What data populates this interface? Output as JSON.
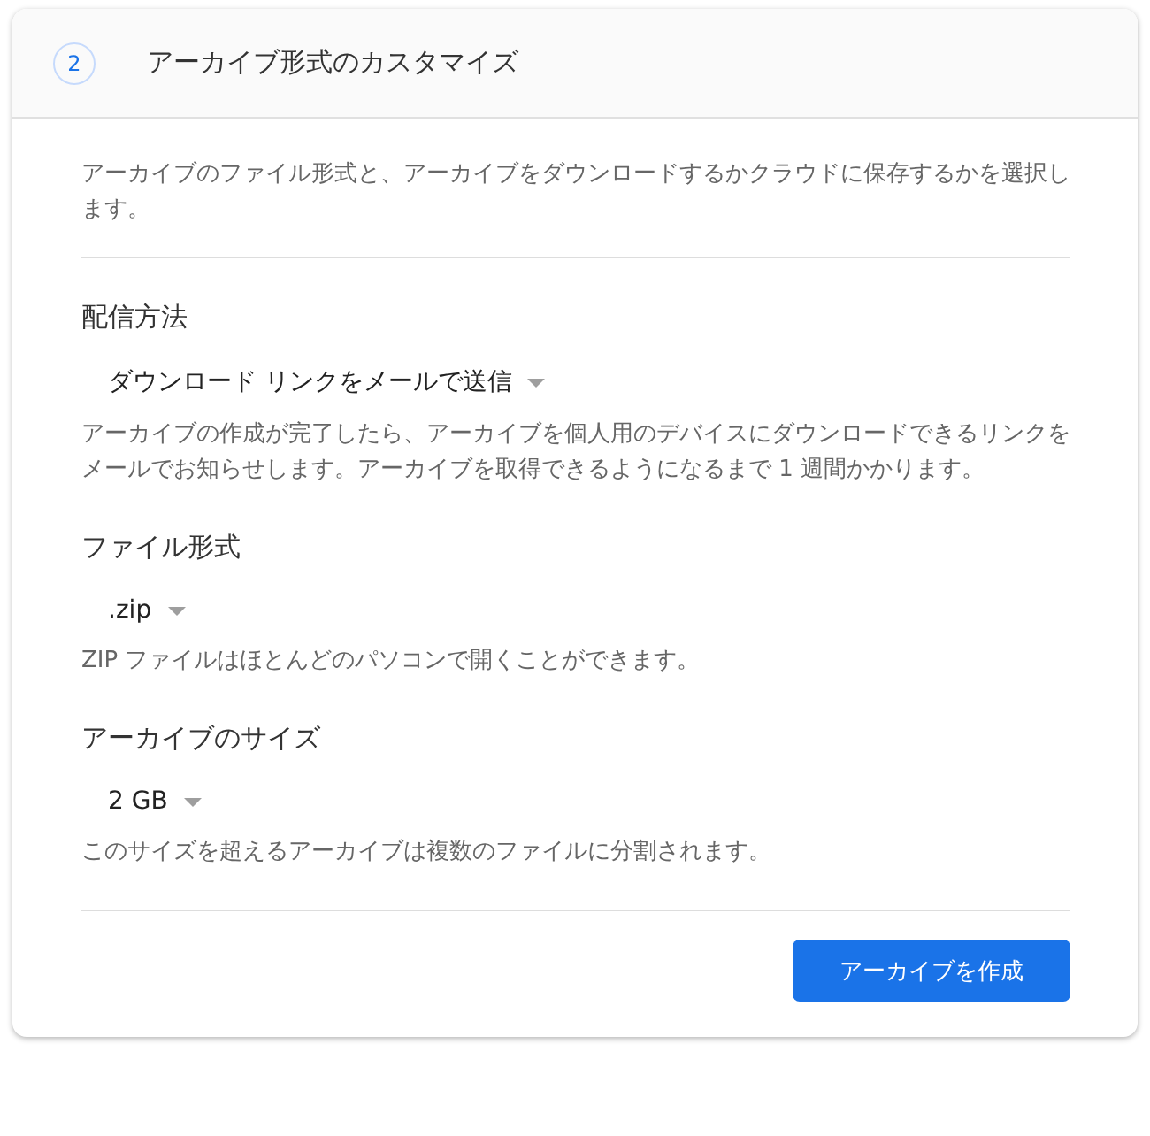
{
  "header": {
    "step": "2",
    "title": "アーカイブ形式のカスタマイズ"
  },
  "intro": "アーカイブのファイル形式と、アーカイブをダウンロードするかクラウドに保存するかを選択します。",
  "sections": [
    {
      "heading": "配信方法",
      "dropdown": "ダウンロード リンクをメールで送信",
      "description": "アーカイブの作成が完了したら、アーカイブを個人用のデバイスにダウンロードできるリンクをメールでお知らせします。アーカイブを取得できるようになるまで 1 週間かかります。"
    },
    {
      "heading": "ファイル形式",
      "dropdown": ".zip",
      "description": "ZIP ファイルはほとんどのパソコンで開くことができます。"
    },
    {
      "heading": "アーカイブのサイズ",
      "dropdown": "2 GB",
      "description": "このサイズを超えるアーカイブは複数のファイルに分割されます。"
    }
  ],
  "button": "アーカイブを作成"
}
